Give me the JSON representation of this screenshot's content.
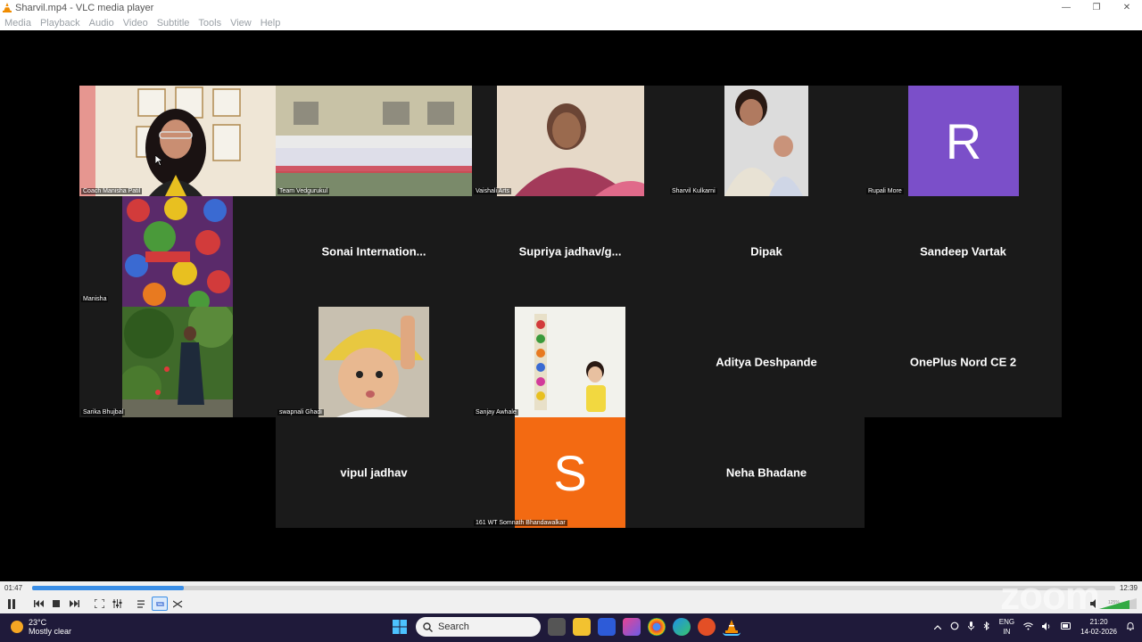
{
  "window": {
    "title": "Sharvil.mp4 - VLC media player",
    "controls": [
      "—",
      "❐",
      "✕"
    ]
  },
  "menu": [
    "Media",
    "Playback",
    "Audio",
    "Video",
    "Subtitle",
    "Tools",
    "View",
    "Help"
  ],
  "tiles": [
    {
      "name": "Coach Manisha Patil",
      "type": "video"
    },
    {
      "name": "Team Vedgurukul",
      "type": "video"
    },
    {
      "name": "Vaishali Arts",
      "type": "video"
    },
    {
      "name": "Sharvil Kulkarni",
      "type": "video"
    },
    {
      "name": "Rupali More",
      "type": "avatar",
      "letter": "R"
    },
    {
      "name": "Manisha",
      "type": "video"
    },
    {
      "name": "Sonai  Internation...",
      "type": "name"
    },
    {
      "name": "Supriya  jadhav/g...",
      "type": "name"
    },
    {
      "name": "Dipak",
      "type": "name"
    },
    {
      "name": "Sandeep Vartak",
      "type": "name"
    },
    {
      "name": "Sarika Bhujbal",
      "type": "video"
    },
    {
      "name": "swapnali Ghadi",
      "type": "video"
    },
    {
      "name": "Sanjay Awhale",
      "type": "video"
    },
    {
      "name": "Aditya Deshpande",
      "type": "name"
    },
    {
      "name": "OnePlus Nord CE 2",
      "type": "name"
    },
    {
      "name": "vipul jadhav",
      "type": "name"
    },
    {
      "name": "161 WT Somnath Bhandawalkar",
      "type": "avatar",
      "letter": "S"
    },
    {
      "name": "Neha Bhadane",
      "type": "name"
    }
  ],
  "player": {
    "elapsed": "01:47",
    "total": "12:39",
    "progress": 0.14,
    "volume_label": "125%",
    "watermark": "zoom"
  },
  "taskbar": {
    "temperature": "23°C",
    "weather": "Mostly clear",
    "search_label": "Search",
    "language_top": "ENG",
    "language_bottom": "IN",
    "time": "21:20",
    "date": "14-02-2026"
  },
  "colors": {
    "avatar_r": "#7b4fc9",
    "avatar_s": "#f36a12",
    "seek_fill": "#3a8ee6",
    "taskbar": "#1f1a3a"
  }
}
